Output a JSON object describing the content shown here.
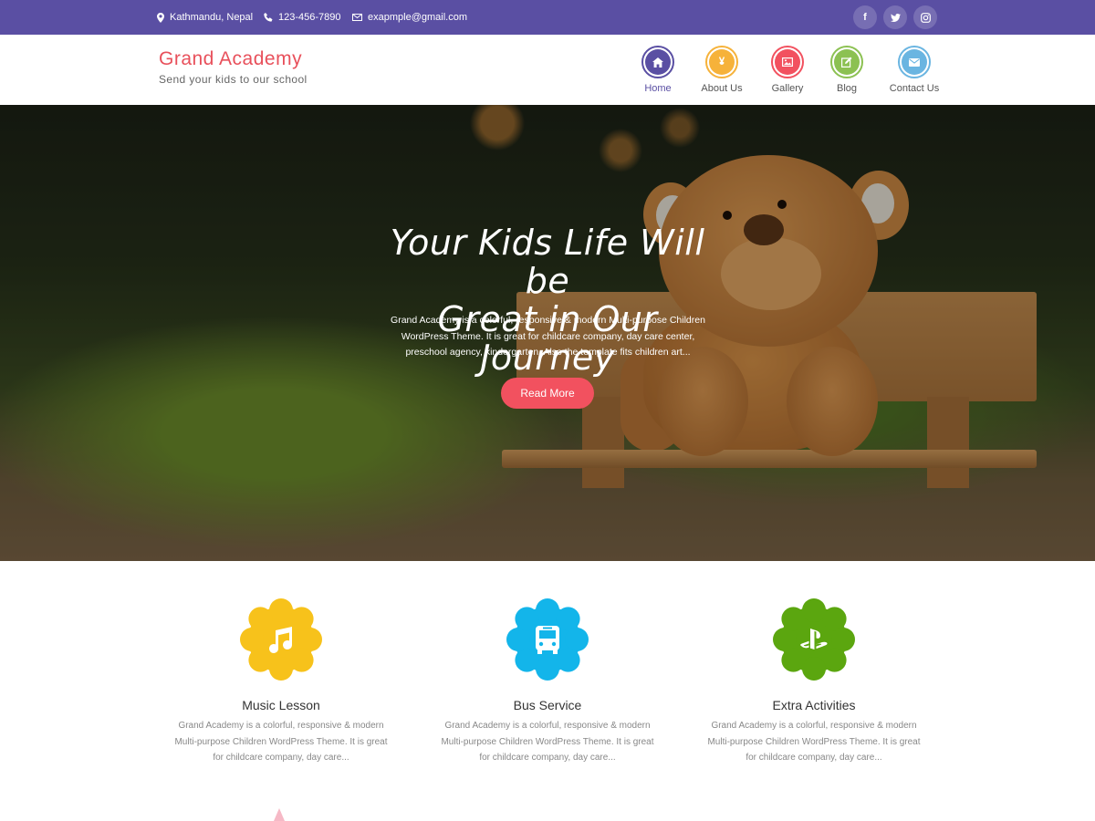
{
  "topbar": {
    "location": "Kathmandu, Nepal",
    "phone": "123-456-7890",
    "email": "exapmple@gmail.com",
    "social": [
      {
        "name": "facebook-icon",
        "glyph": "f"
      },
      {
        "name": "twitter-icon",
        "glyph": "t"
      },
      {
        "name": "instagram-icon",
        "glyph": "◎"
      }
    ],
    "background": "#5a4fa3"
  },
  "header": {
    "site_title": "Grand Academy",
    "tagline": "Send your kids to our school",
    "nav": [
      {
        "label": "Home",
        "color": "#5a4fa3",
        "icon": "home-icon"
      },
      {
        "label": "About Us",
        "color": "#f6b23a",
        "icon": "about-icon"
      },
      {
        "label": "Gallery",
        "color": "#f2515f",
        "icon": "gallery-icon"
      },
      {
        "label": "Blog",
        "color": "#8cc152",
        "icon": "blog-icon"
      },
      {
        "label": "Contact Us",
        "color": "#6ab5e1",
        "icon": "contact-icon"
      }
    ]
  },
  "hero": {
    "title_line1": "Your Kids Life Will be",
    "title_line2": "Great in Our Journey",
    "text": "Grand Academy is a colorful, responsive & modern Multi-purpose Children WordPress Theme. It is great for childcare company, day care center, preschool agency, kindergarten. Also the template fits children art...",
    "button_label": "Read More",
    "button_color": "#f2515f"
  },
  "features": [
    {
      "title": "Music Lesson",
      "text": "Grand Academy is a colorful, responsive & modern Multi-purpose Children WordPress Theme. It is great for childcare company, day care...",
      "color": "#f7c21b",
      "icon": "music-note-icon"
    },
    {
      "title": "Bus Service",
      "text": "Grand Academy is a colorful, responsive & modern Multi-purpose Children WordPress Theme. It is great for childcare company, day care...",
      "color": "#13b5ea",
      "icon": "bus-icon"
    },
    {
      "title": "Extra Activities",
      "text": "Grand Academy is a colorful, responsive & modern Multi-purpose Children WordPress Theme. It is great for childcare company, day care...",
      "color": "#5ba60f",
      "icon": "playstation-icon"
    }
  ]
}
